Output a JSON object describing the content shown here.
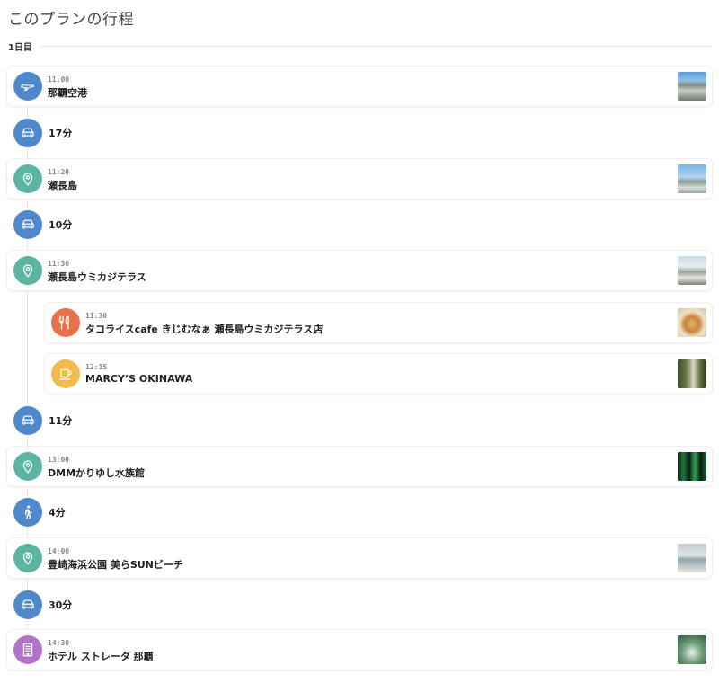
{
  "header": {
    "title": "このプランの行程"
  },
  "day": {
    "label": "1日目"
  },
  "colors": {
    "transit": "#4f89cc",
    "spot": "#5bb5a2",
    "restaurant": "#e8704a",
    "cafe": "#f2bb4c",
    "hotel": "#b075c9"
  },
  "itinerary": {
    "airport": {
      "icon": "airplane-icon",
      "time": "11:00",
      "name": "那覇空港"
    },
    "move1": {
      "icon": "car-icon",
      "duration": "17分"
    },
    "senaga": {
      "icon": "map-pin-icon",
      "time": "11:20",
      "name": "瀬長島"
    },
    "move2": {
      "icon": "car-icon",
      "duration": "10分"
    },
    "terrace": {
      "icon": "map-pin-icon",
      "time": "11:30",
      "name": "瀬長島ウミカジテラス"
    },
    "taco": {
      "icon": "fork-knife-icon",
      "time": "11:30",
      "name": "タコライスcafe きじむなぁ 瀬長島ウミカジテラス店"
    },
    "marcy": {
      "icon": "coffee-cup-icon",
      "time": "12:15",
      "name": "MARCY’S OKINAWA"
    },
    "move3": {
      "icon": "car-icon",
      "duration": "11分"
    },
    "aquarium": {
      "icon": "map-pin-icon",
      "time": "13:00",
      "name": "DMMかりゆし水族館"
    },
    "move4": {
      "icon": "walking-person-icon",
      "duration": "4分"
    },
    "beach": {
      "icon": "map-pin-icon",
      "time": "14:00",
      "name": "豊崎海浜公園 美らSUNビーチ"
    },
    "move5": {
      "icon": "car-icon",
      "duration": "30分"
    },
    "hotel": {
      "icon": "building-icon",
      "time": "14:30",
      "name": "ホテル ストレータ 那覇"
    }
  }
}
